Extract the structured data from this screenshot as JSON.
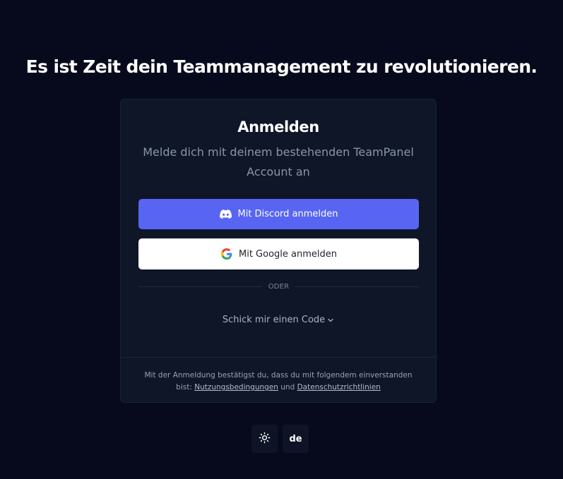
{
  "headline": "Es ist Zeit dein Teammanagement zu revolutionieren.",
  "login": {
    "title": "Anmelden",
    "subtitle": "Melde dich mit deinem bestehenden TeamPanel Account an",
    "discord_label": "Mit Discord anmelden",
    "google_label": "Mit Google anmelden",
    "divider_text": "ODER",
    "code_link_label": "Schick mir einen Code",
    "footer": {
      "prefix": "Mit der Anmeldung bestätigst du, dass du mit folgendem einverstanden bist:",
      "terms_label": "Nutzungsbedingungen",
      "conjunction": "und",
      "privacy_label": "Datenschutzrichtlinien"
    }
  },
  "controls": {
    "theme_icon": "sun-icon",
    "language_label": "de"
  },
  "colors": {
    "background": "#060a1c",
    "card": "#0e1627",
    "discord": "#5865f2",
    "google_button": "#ffffff"
  }
}
